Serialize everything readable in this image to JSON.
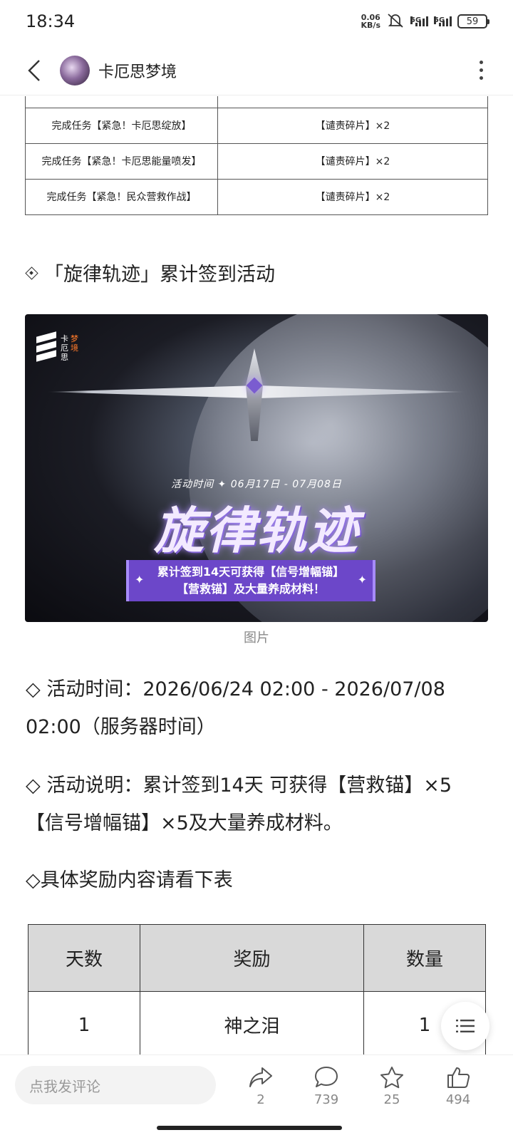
{
  "status_bar": {
    "time": "18:34",
    "net_speed_value": "0.06",
    "net_speed_unit": "KB/s",
    "signal1_label": "5G",
    "signal2_label": "5G",
    "battery": "59"
  },
  "header": {
    "title": "卡厄思梦境"
  },
  "task_table": {
    "rows": [
      {
        "task": "完成任务【紧急！卡厄思绽放】",
        "reward": "【谴责碎片】×2"
      },
      {
        "task": "完成任务【紧急！卡厄思能量喷发】",
        "reward": "【谴责碎片】×2"
      },
      {
        "task": "完成任务【紧急！民众营救作战】",
        "reward": "【谴责碎片】×2"
      }
    ]
  },
  "section": {
    "heading": "「旋律轨迹」累计签到活动"
  },
  "banner": {
    "logo_chars": [
      "卡",
      "梦",
      "厄",
      "境",
      "思"
    ],
    "time_label": "活动时间 ✦ 06月17日 - 07月08日",
    "title": "旋律轨迹",
    "box_line1": "累计签到14天可获得【信号增幅锚】",
    "box_line2": "【营救锚】及大量养成材料！"
  },
  "caption": "图片",
  "paragraphs": {
    "time": "◇ 活动时间：2026/06/24  02:00 - 2026/07/08 02:00（服务器时间）",
    "desc": "◇ 活动说明：累计签到14天 可获得【营救锚】×5 【信号增幅锚】×5及大量养成材料。",
    "note": "◇具体奖励内容请看下表"
  },
  "reward_table": {
    "headers": [
      "天数",
      "奖励",
      "数量"
    ],
    "rows": [
      {
        "day": "1",
        "reward": "神之泪",
        "qty": "1"
      }
    ]
  },
  "bottom_bar": {
    "comment_placeholder": "点我发评论",
    "share_count": "2",
    "comment_count": "739",
    "favorite_count": "25",
    "like_count": "494"
  }
}
